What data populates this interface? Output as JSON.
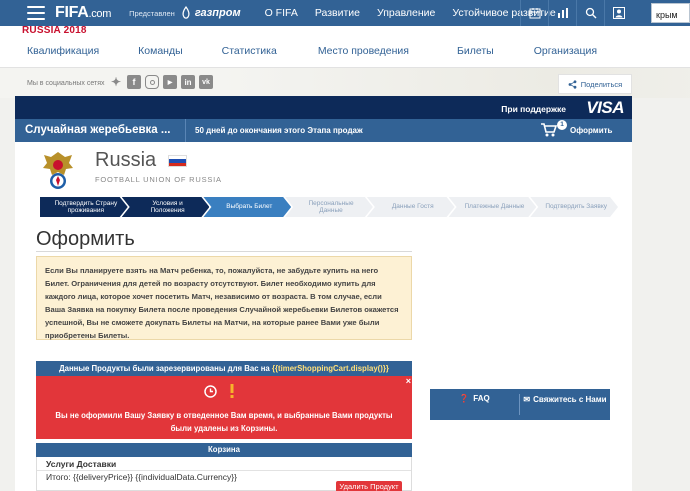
{
  "topbar": {
    "logo": "FIFA",
    "logo_suffix": ".com",
    "presented_by": "Представлен",
    "sponsor": "газпром",
    "nav": [
      "О FIFA",
      "Развитие",
      "Управление",
      "Устойчивое развитие"
    ],
    "search_value": "крым"
  },
  "subheader": {
    "event": "RUSSIA 2018",
    "nav": [
      "Квалификация",
      "Команды",
      "Статистика",
      "Место проведения",
      "Билеты",
      "Организация"
    ]
  },
  "social": {
    "label": "Мы в социальных сетях",
    "icons": [
      "twitter-icon",
      "facebook-icon",
      "instagram-icon",
      "youtube-icon",
      "linkedin-icon",
      "vk-icon"
    ],
    "share_label": "Поделиться"
  },
  "visa": {
    "supported_by": "При поддержке",
    "brand": "VISA"
  },
  "drawbar": {
    "title": "Случайная жеребьевка ...",
    "days_left": "50 дней до окончания этого Этапа продаж",
    "cart_count": "1",
    "checkout_label": "Оформить"
  },
  "team": {
    "name": "Russia",
    "union": "FOOTBALL UNION OF RUSSIA"
  },
  "steps": [
    {
      "label": "Подтвердить Страну проживания",
      "state": "done"
    },
    {
      "label": "Условия и Положения",
      "state": "done"
    },
    {
      "label": "Выбрать Билет",
      "state": "current"
    },
    {
      "label": "Персональные Данные",
      "state": "todo"
    },
    {
      "label": "Данные Гостя",
      "state": "todo"
    },
    {
      "label": "Платежные Данные",
      "state": "todo"
    },
    {
      "label": "Подтвердить Заявку",
      "state": "todo"
    }
  ],
  "main": {
    "title": "Оформить",
    "notice": "Если Вы планируете взять на Матч ребенка, то, пожалуйста, не забудьте купить на него Билет. Ограничения для детей по возрасту отсутствуют. Билет необходимо купить для каждого лица, которое хочет посетить Матч, независимо от возраста. В том случае, если Ваша Заявка на покупку Билета после проведения Случайной жеребьевки Билетов окажется успешной, Вы не сможете докупать Билеты на Матчи, на которые ранее Вами уже были приобретены Билеты.",
    "reserved_prefix": "Данные Продукты были зарезервированы для Вас на",
    "reserved_template": "{{timerShoppingCart.display()}}",
    "alert_close": "×",
    "alert_text": "Вы не оформили Вашу Заявку в отведенное Вам время, и выбранные Вами продукты были удалены из Корзины.",
    "basket_title": "Корзина",
    "delivery_services": "Услуги Доставки",
    "total": "Итого: {{deliveryPrice}} {{individualData.Currency}}",
    "remove_label": "Удалить Продукт"
  },
  "help": {
    "faq": "FAQ",
    "contact": "Свяжитесь с Нами"
  },
  "colors": {
    "navy": "#326295",
    "dark_navy": "#0d2a59",
    "alert_red": "#e2363a",
    "notice_bg": "#fdf1d4"
  }
}
